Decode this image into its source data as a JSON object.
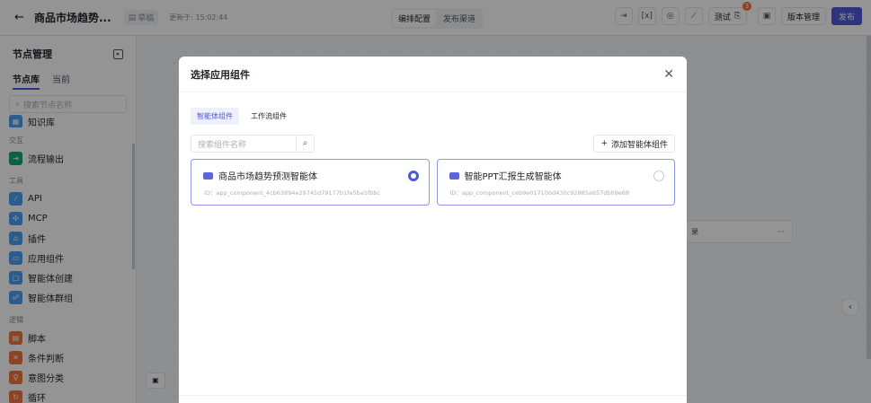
{
  "header": {
    "back_icon": "arrow-left-icon",
    "title": "商品市场趋势...",
    "draft_label": "草稿",
    "updated_text": "更新于: 15:02:44",
    "tabs": [
      "编排配置",
      "发布渠道"
    ],
    "test_label": "测试",
    "badge_count": "3",
    "version_label": "版本管理",
    "publish_label": "发布"
  },
  "sidebar": {
    "title": "节点管理",
    "tabs": [
      "节点库",
      "当前"
    ],
    "search_placeholder": "搜索节点名称",
    "partial_item": "知识库",
    "groups": [
      {
        "label": "交互",
        "items": [
          "流程输出"
        ]
      },
      {
        "label": "工具",
        "items": [
          "API",
          "MCP",
          "插件",
          "应用组件",
          "智能体创建",
          "智能体群组"
        ]
      },
      {
        "label": "逻辑",
        "items": [
          "脚本",
          "条件判断",
          "意图分类",
          "循环"
        ]
      }
    ]
  },
  "canvas": {
    "node_label": "果",
    "node_more": "···",
    "collapse_arrow": "‹"
  },
  "modal": {
    "title": "选择应用组件",
    "close_icon": "close-icon",
    "tabs": [
      "智能体组件",
      "工作流组件"
    ],
    "search_placeholder": "搜索组件名称",
    "add_label": "添加智能体组件",
    "cards": [
      {
        "title": "商品市场趋势预测智能体",
        "id": "ID：app_component_4cb63894e29745d79177b1fe5ba5fbbc",
        "selected": true
      },
      {
        "title": "智能PPT汇报生成智能体",
        "id": "ID：app_component_ceb9e01710bd430c92985a657db09e68",
        "selected": false
      }
    ]
  },
  "colors": {
    "primary": "#4d5bd9",
    "badge": "#f77234"
  }
}
